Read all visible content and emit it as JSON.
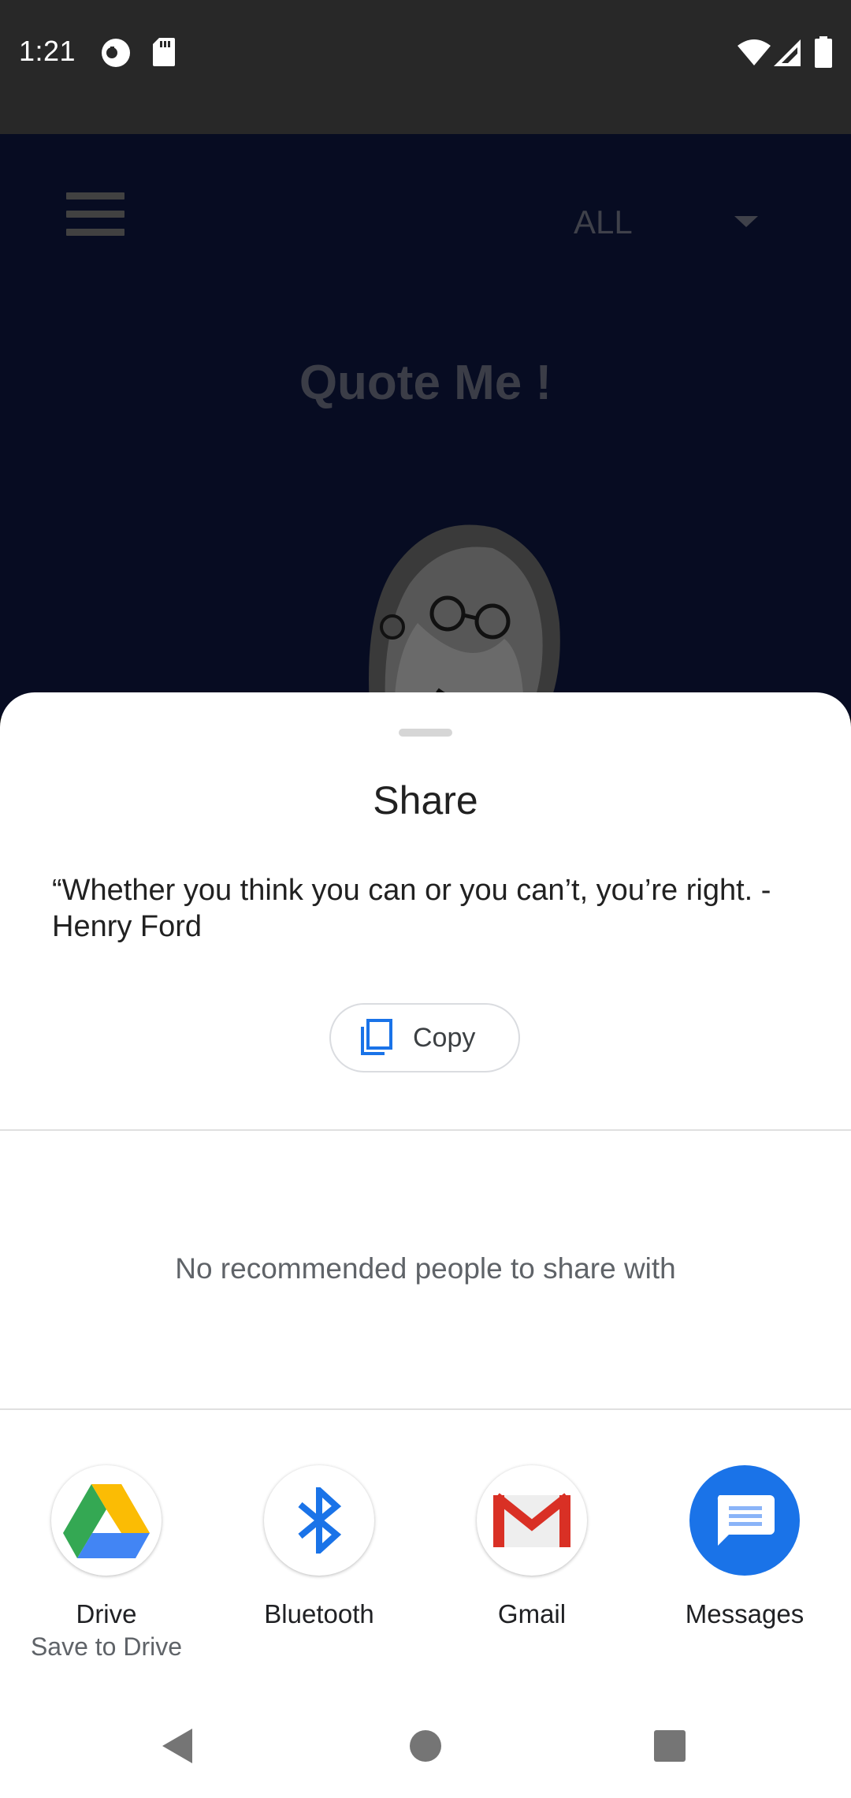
{
  "status_bar": {
    "time": "1:21",
    "icons": [
      "notification-circle-icon",
      "sd-card-icon",
      "wifi-icon",
      "signal-icon",
      "battery-icon"
    ]
  },
  "app": {
    "menu_icon": "hamburger-menu-icon",
    "filter_value": "ALL",
    "title": "Quote Me !",
    "image": "caricature-portrait"
  },
  "share_sheet": {
    "title": "Share",
    "text": "“Whether you think you can or you can’t, you’re right. - Henry Ford",
    "copy_label": "Copy",
    "no_people_text": "No recommended people to share with",
    "apps": [
      {
        "label": "Drive",
        "sublabel": "Save to Drive",
        "icon": "google-drive-icon"
      },
      {
        "label": "Bluetooth",
        "sublabel": "",
        "icon": "bluetooth-icon"
      },
      {
        "label": "Gmail",
        "sublabel": "",
        "icon": "gmail-icon"
      },
      {
        "label": "Messages",
        "sublabel": "",
        "icon": "messages-icon"
      }
    ]
  },
  "nav_bar": {
    "buttons": [
      "back-icon",
      "home-icon",
      "recents-icon"
    ]
  },
  "colors": {
    "status_bar_bg": "#282828",
    "app_bg_dimmed": "#070c22",
    "sheet_bg": "#ffffff",
    "accent_blue": "#1a73e8"
  }
}
